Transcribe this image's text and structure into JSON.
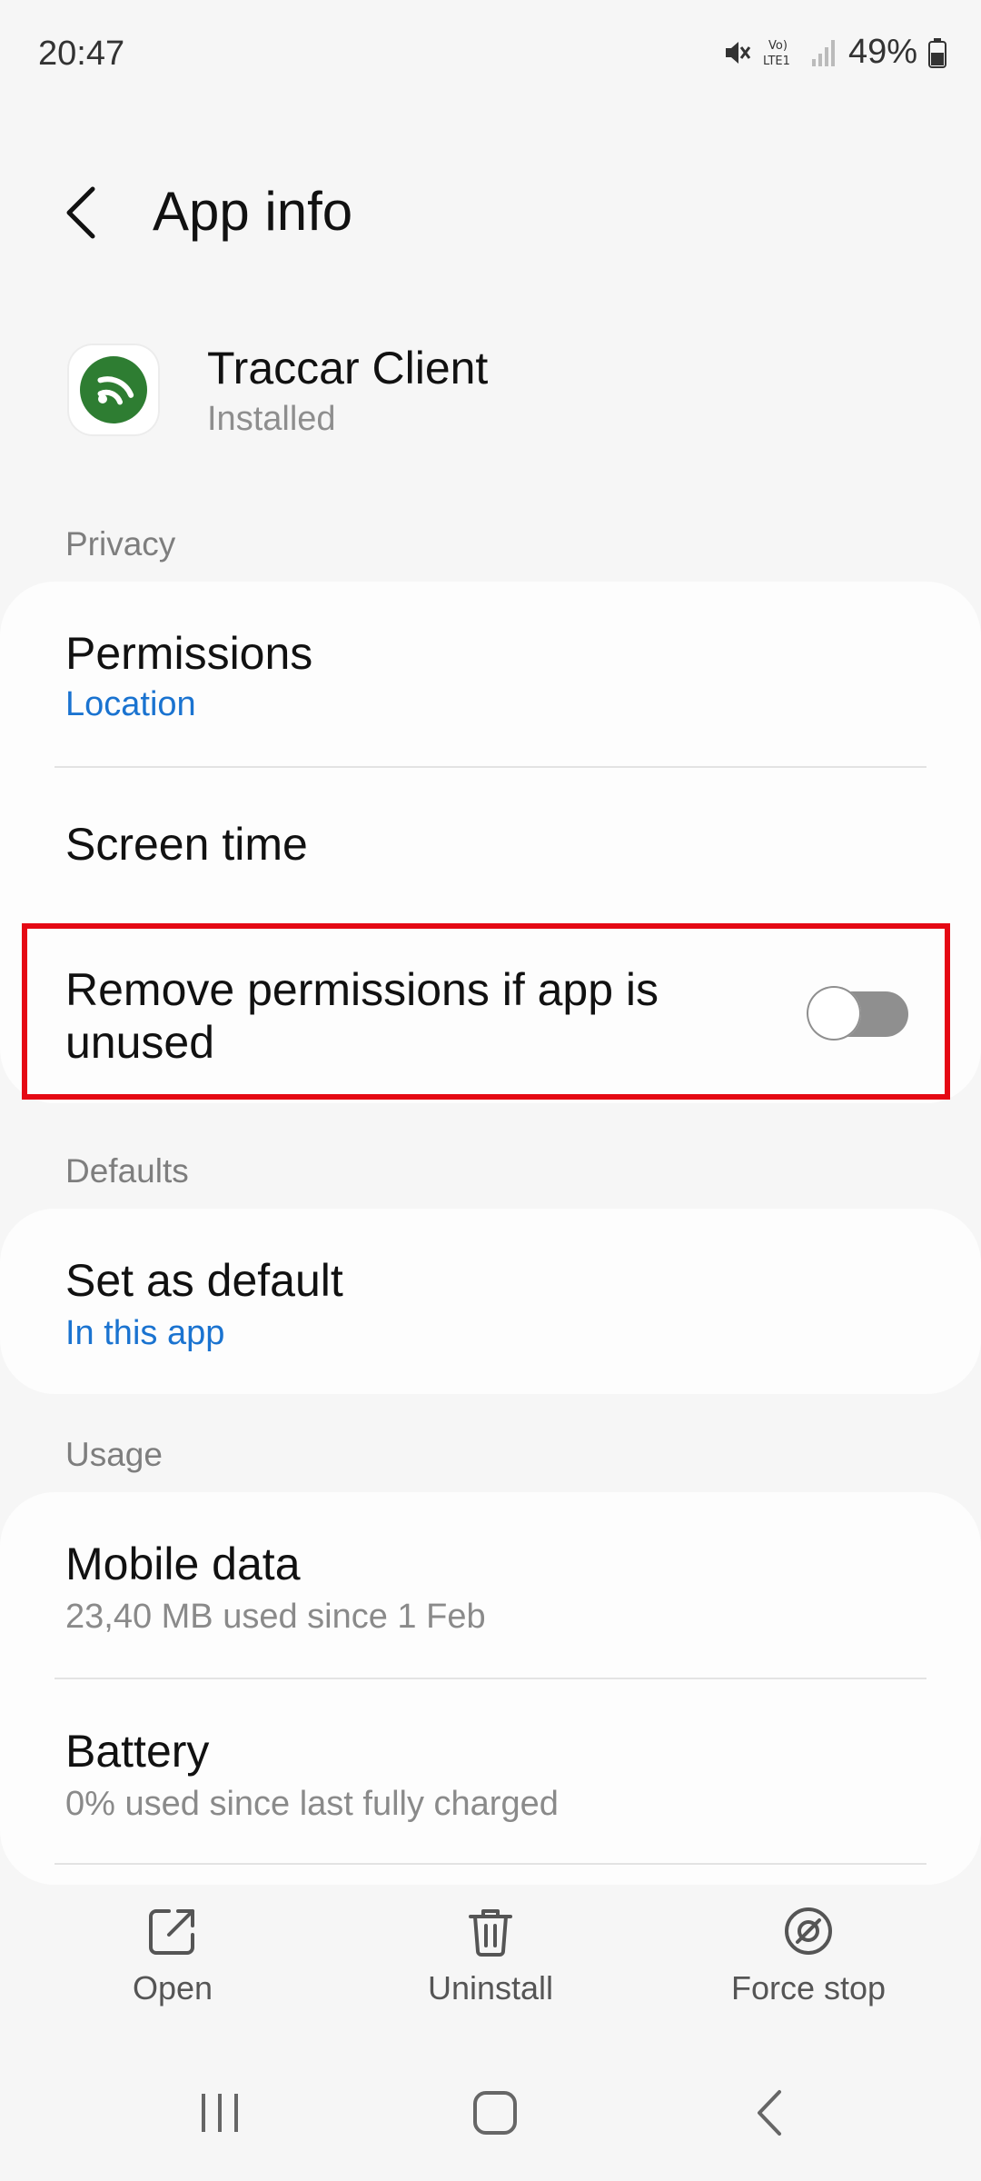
{
  "status_bar": {
    "time": "20:47",
    "network_label": "Vo) LTE1",
    "battery": "49%",
    "icons": [
      "mute-icon",
      "volte-icon",
      "signal-icon",
      "battery-icon"
    ]
  },
  "header": {
    "title": "App info",
    "back_icon": "back-arrow-icon"
  },
  "app": {
    "name": "Traccar Client",
    "status": "Installed",
    "icon": "traccar-app-icon",
    "icon_color": "#2e7d32"
  },
  "sections": {
    "privacy": {
      "label": "Privacy",
      "items": [
        {
          "title": "Permissions",
          "subtitle": "Location"
        },
        {
          "title": "Screen time"
        },
        {
          "title_line1": "Remove permissions if app is",
          "title_line2": "unused",
          "toggle_on": false
        }
      ]
    },
    "defaults": {
      "label": "Defaults",
      "items": [
        {
          "title": "Set as default",
          "subtitle": "In this app"
        }
      ]
    },
    "usage": {
      "label": "Usage",
      "items": [
        {
          "title": "Mobile data",
          "subtitle": "23,40 MB used since 1 Feb"
        },
        {
          "title": "Battery",
          "subtitle": "0% used since last fully charged"
        }
      ]
    }
  },
  "actions": [
    {
      "label": "Open",
      "icon": "open-external-icon"
    },
    {
      "label": "Uninstall",
      "icon": "trash-icon"
    },
    {
      "label": "Force stop",
      "icon": "force-stop-icon"
    }
  ],
  "colors": {
    "accent_link": "#1a73d0",
    "highlight": "#e50914",
    "background": "#f6f6f6",
    "card": "#fdfdfd"
  }
}
